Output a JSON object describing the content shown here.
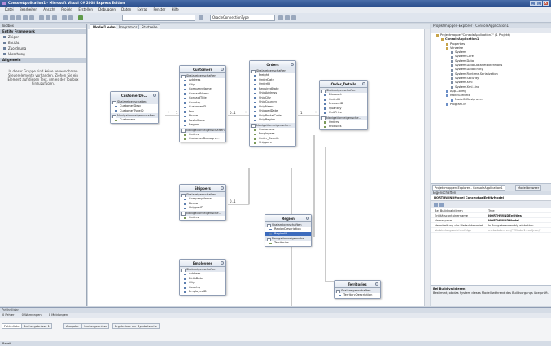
{
  "window": {
    "title": "ConsoleApplication1 - Microsoft Visual C# 2008 Express Edition",
    "controls": [
      "_",
      "□",
      "×"
    ]
  },
  "menu": [
    "Datei",
    "Bearbeiten",
    "Ansicht",
    "Projekt",
    "Erstellen",
    "Debuggen",
    "Daten",
    "Extras",
    "Fenster",
    "Hilfe"
  ],
  "toolbar": {
    "combo_value": "OracleConnectionType"
  },
  "toolbox": {
    "title": "Toolbox",
    "category_entity": "Entity Framework",
    "items": [
      "Zeiger",
      "Entität",
      "Zuordnung",
      "Vererbung"
    ],
    "category_general": "Allgemein",
    "info_text": "In dieser Gruppe sind keine verwendbaren Steuerelemente vorhanden. Ziehen Sie ein Element auf diesen Text, um es der Toolbox hinzuzufügen."
  },
  "editor": {
    "tabs": [
      "Model1.edmx",
      "Program.cs",
      "Startseite"
    ],
    "active_tab": 0
  },
  "entities": {
    "customerdemo": {
      "name": "CustomerDe...",
      "props_header": "Skalareigenschaften",
      "props": [
        "CustomerDesc",
        "CustomerTypeID"
      ],
      "nav_header": "Navigationseigenschaften",
      "navs": [
        "Customers"
      ]
    },
    "customers": {
      "name": "Customers",
      "props_header": "Skalareigenschaften",
      "props": [
        "Address",
        "City",
        "CompanyName",
        "ContactName",
        "ContactTitle",
        "Country",
        "CustomerID",
        "Fax",
        "Phone",
        "PostalCode",
        "Region"
      ],
      "nav_header": "Navigationseigenschaften",
      "navs": [
        "Orders",
        "CustomerDemogra..."
      ]
    },
    "orders": {
      "name": "Orders",
      "props_header": "Skalareigenschaften",
      "props": [
        "Freight",
        "OrderDate",
        "OrderID",
        "RequiredDate",
        "ShipAddress",
        "ShipCity",
        "ShipCountry",
        "ShipName",
        "ShippedDate",
        "ShipPostalCode",
        "ShipRegion"
      ],
      "nav_header": "Navigationseigensche...",
      "navs": [
        "Customers",
        "Employees",
        "Order_Details",
        "Shippers"
      ]
    },
    "orderdetails": {
      "name": "Order_Details",
      "props_header": "Skalareigenschaften",
      "props": [
        "Discount",
        "OrderID",
        "ProductID",
        "Quantity",
        "UnitPrice"
      ],
      "nav_header": "Navigationseigensche...",
      "navs": [
        "Orders",
        "Products"
      ]
    },
    "shippers": {
      "name": "Shippers",
      "props_header": "Skalareigenschaften",
      "props": [
        "CompanyName",
        "Phone",
        "ShipperID"
      ],
      "nav_header": "Navigationseigensche...",
      "navs": [
        "Orders"
      ]
    },
    "region": {
      "name": "Region",
      "props_header": "Skalareigenschaften",
      "props": [
        "RegionDescription",
        "RegionID"
      ],
      "nav_header": "Navigationseigensche...",
      "navs": [
        "Territories"
      ]
    },
    "employees": {
      "name": "Employees",
      "props_header": "Skalareigenschaften",
      "props": [
        "Address",
        "BirthDate",
        "City",
        "Country",
        "EmployeeID"
      ]
    },
    "territories": {
      "name": "Territories",
      "props_header": "Skalareigenschaften",
      "props": [
        "TerritoryDescription"
      ]
    }
  },
  "relations": {
    "one": "1",
    "many": "*",
    "zero_one": "0..1"
  },
  "solution": {
    "title": "Projektmappen-Explorer - ConsoleApplication1",
    "rows": [
      {
        "label": "Projektmappe \"ConsoleApplication1\" (1 Projekt)",
        "indent": 1,
        "kind": "sln"
      },
      {
        "label": "ConsoleApplication1",
        "indent": 2,
        "kind": "proj",
        "bold": true
      },
      {
        "label": "Properties",
        "indent": 3,
        "kind": "folder"
      },
      {
        "label": "Verweise",
        "indent": 3,
        "kind": "folder"
      },
      {
        "label": "System",
        "indent": 4,
        "kind": "ref"
      },
      {
        "label": "System.Core",
        "indent": 4,
        "kind": "ref"
      },
      {
        "label": "System.Data",
        "indent": 4,
        "kind": "ref"
      },
      {
        "label": "System.Data.DataSetExtensions",
        "indent": 4,
        "kind": "ref"
      },
      {
        "label": "System.Data.Entity",
        "indent": 4,
        "kind": "ref"
      },
      {
        "label": "System.Runtime.Serialization",
        "indent": 4,
        "kind": "ref"
      },
      {
        "label": "System.Security",
        "indent": 4,
        "kind": "ref"
      },
      {
        "label": "System.Xml",
        "indent": 4,
        "kind": "ref"
      },
      {
        "label": "System.Xml.Linq",
        "indent": 4,
        "kind": "ref"
      },
      {
        "label": "App.Config",
        "indent": 3,
        "kind": "file"
      },
      {
        "label": "Model1.edmx",
        "indent": 3,
        "kind": "file"
      },
      {
        "label": "Model1.Designer.cs",
        "indent": 4,
        "kind": "file"
      },
      {
        "label": "Program.cs",
        "indent": 3,
        "kind": "file"
      }
    ],
    "bottom_tabs": [
      "Projektmappen-Explorer - ConsoleApplication1",
      "Modellbrowser"
    ]
  },
  "properties": {
    "title": "Eigenschaften",
    "object": "NORTHWINDModel ConceptualEntityModel",
    "rows": [
      {
        "key": "Bei Build validieren",
        "value": "True",
        "dim": false
      },
      {
        "key": "Entitätscontainername",
        "value": "NORTHWINDEntities",
        "dim": false
      },
      {
        "key": "Namespace",
        "value": "NORTHWINDModel",
        "dim": false
      },
      {
        "key": "Verarbeitung der Metadatenartef",
        "value": "In Ausgabeassembly einbetten",
        "dim": false
      },
      {
        "key": "Verbindungszeichenfolge",
        "value": "metadata=res://*/Model1.csdl|res://",
        "dim": true
      }
    ],
    "desc_title": "Bei Build validieren",
    "desc_text": "Bestimmt, ob das System dieses Modell während des Buildvorgangs überprüft."
  },
  "errorlist": {
    "title": "Fehlerliste",
    "filters": [
      "0 Fehler",
      "0 Warnungen",
      "0 Meldungen"
    ],
    "bottom_tabs": [
      "Fehlerliste",
      "Suchergebnisse 1",
      "Ausgabe",
      "Suchergebnisse",
      "Ergebnisse der Symbolsuche"
    ]
  },
  "status": "Bereit"
}
